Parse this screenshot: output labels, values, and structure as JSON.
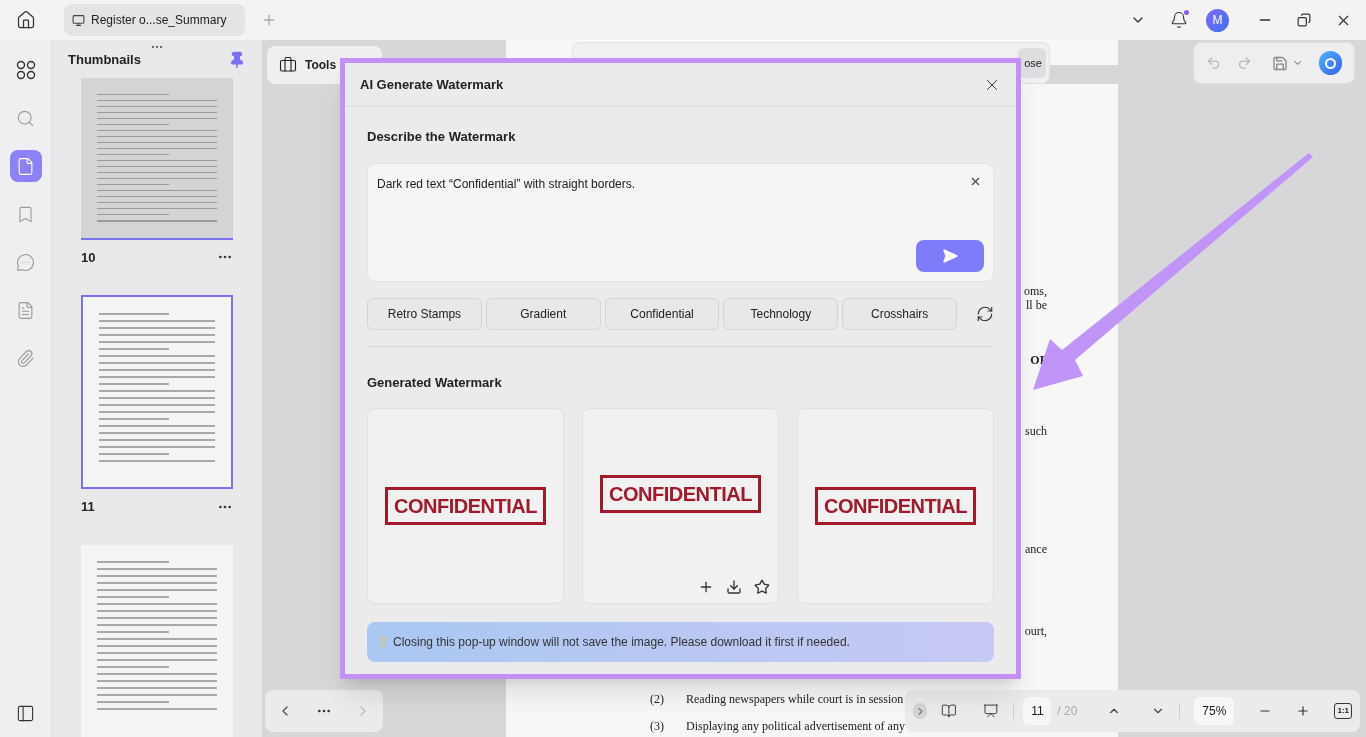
{
  "tabs": [
    {
      "title": "Register o...se_Summary",
      "selected": true
    }
  ],
  "user": {
    "initial": "M"
  },
  "notifications": {
    "unread": true
  },
  "sidebar_items": [
    {
      "selected": false
    },
    {
      "selected": false
    },
    {
      "selected": true
    },
    {
      "selected": false
    },
    {
      "selected": false
    },
    {
      "selected": false
    },
    {
      "selected": false
    }
  ],
  "thumbnails": {
    "title": "Thumbnails",
    "pinned": true,
    "pages": [
      {
        "label": "10",
        "selected": false
      },
      {
        "label": "11",
        "selected": true
      },
      {
        "selected": false
      }
    ]
  },
  "tools_button": {
    "label": "Tools"
  },
  "toolbar_button": {
    "label": "ose"
  },
  "history": {
    "undo_disabled": true,
    "redo_disabled": true
  },
  "document": {
    "fragments": [
      {
        "text": "oms,",
        "bold": false
      },
      {
        "text": "ll be",
        "bold": false
      },
      {
        "text": "OF",
        "bold": true
      },
      {
        "text": "such",
        "bold": false
      },
      {
        "text": "ance",
        "bold": false
      },
      {
        "text": "ourt,",
        "bold": false
      }
    ],
    "list": [
      {
        "number": "(2)",
        "text": "Reading newspapers while court is in session"
      },
      {
        "number": "(3)",
        "text": "Displaying any political advertisement of any"
      }
    ]
  },
  "dialog": {
    "title": "AI Generate Watermark",
    "describe_title": "Describe the Watermark",
    "prompt": "Dark red text “Confidential” with straight borders.",
    "chips": [
      "Retro Stamps",
      "Gradient",
      "Confidential",
      "Technology",
      "Crosshairs"
    ],
    "generated_title": "Generated Watermark",
    "results": [
      {
        "text": "CONFIDENTIAL",
        "hovered": false
      },
      {
        "text": "CONFIDENTIAL",
        "hovered": true
      },
      {
        "text": "CONFIDENTIAL",
        "hovered": false
      }
    ],
    "notice": "Closing this pop-up window will not save the image. Please download it first if needed."
  },
  "page_nav": {
    "next_disabled": true
  },
  "bottom_toolbar": {
    "current_page": "11",
    "total": "/ 20",
    "zoom": "75%",
    "actual_size": "1:1"
  }
}
